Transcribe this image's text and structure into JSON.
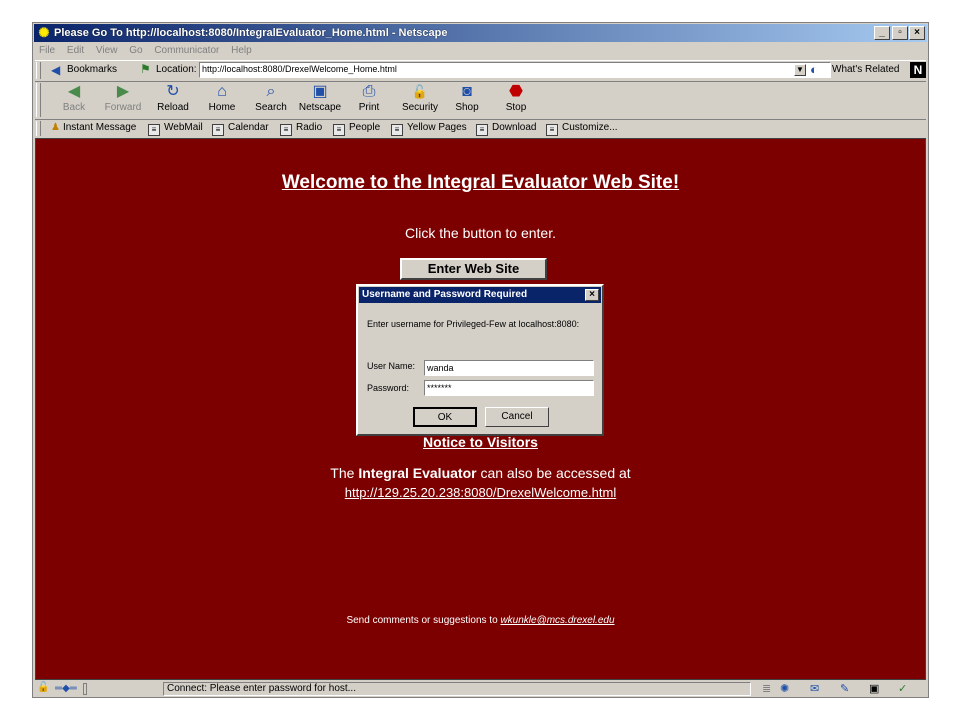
{
  "window": {
    "title": "Please Go To http://localhost:8080/IntegralEvaluator_Home.html - Netscape",
    "controls": {
      "minimize": "_",
      "maximize": "▫",
      "close": "×"
    }
  },
  "menu": [
    "File",
    "Edit",
    "View",
    "Go",
    "Communicator",
    "Help"
  ],
  "location_bar": {
    "bookmarks_label": "Bookmarks",
    "location_label": "Location:",
    "url": "http://localhost:8080/DrexelWelcome_Home.html",
    "whats_related": "What's Related",
    "logo": "N"
  },
  "nav_buttons": [
    {
      "label": "Back",
      "icon": "back-icon",
      "glyph": "◀"
    },
    {
      "label": "Forward",
      "icon": "forward-icon",
      "glyph": "▶"
    },
    {
      "label": "Reload",
      "icon": "reload-icon",
      "glyph": "↻"
    },
    {
      "label": "Home",
      "icon": "home-icon",
      "glyph": "⌂"
    },
    {
      "label": "Search",
      "icon": "search-icon",
      "glyph": "⌕"
    },
    {
      "label": "Netscape",
      "icon": "netscape-icon",
      "glyph": "▣"
    },
    {
      "label": "Print",
      "icon": "print-icon",
      "glyph": "⎙"
    },
    {
      "label": "Security",
      "icon": "security-icon",
      "glyph": "🔓"
    },
    {
      "label": "Shop",
      "icon": "shop-icon",
      "glyph": "◙"
    },
    {
      "label": "Stop",
      "icon": "stop-icon",
      "glyph": "⬣"
    }
  ],
  "personal_toolbar": [
    "Instant Message",
    "WebMail",
    "Calendar",
    "Radio",
    "People",
    "Yellow Pages",
    "Download",
    "Customize..."
  ],
  "page": {
    "heading": "Welcome to the Integral Evaluator Web Site!",
    "instruction": "Click the button to enter.",
    "enter_button": "Enter Web Site",
    "notice_link": "Notice to Visitors",
    "access_prefix": "The ",
    "access_bold": "Integral Evaluator",
    "access_suffix": " can also be accessed at",
    "access_url": "http://129.25.20.238:8080/DrexelWelcome.html",
    "comments_prefix": "Send comments or suggestions to ",
    "comments_email": "wkunkle@mcs.drexel.edu",
    "background_color": "#7c0000"
  },
  "dialog": {
    "title": "Username and Password Required",
    "close": "×",
    "prompt": "Enter username for Privileged-Few at localhost:8080:",
    "username_label": "User Name:",
    "username_value": "wanda",
    "password_label": "Password:",
    "password_value": "*******",
    "ok_label": "OK",
    "cancel_label": "Cancel"
  },
  "status": {
    "text": "Connect: Please enter password for host..."
  }
}
